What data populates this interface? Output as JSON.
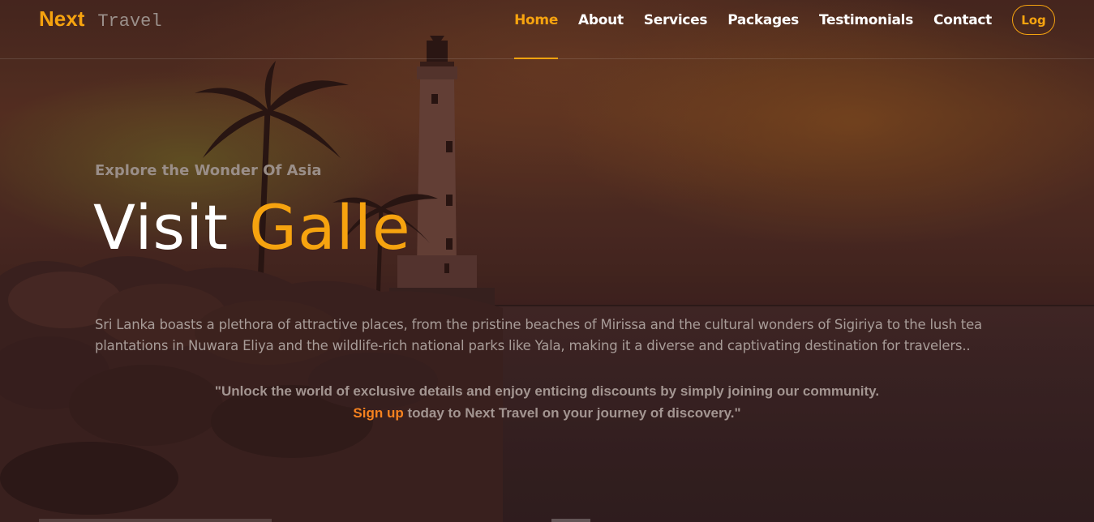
{
  "brand": {
    "main": "Next",
    "sub": "Travel"
  },
  "nav": {
    "items": [
      {
        "label": "Home",
        "active": true
      },
      {
        "label": "About",
        "active": false
      },
      {
        "label": "Services",
        "active": false
      },
      {
        "label": "Packages",
        "active": false
      },
      {
        "label": "Testimonials",
        "active": false
      },
      {
        "label": "Contact",
        "active": false
      }
    ],
    "log_label": "Log"
  },
  "hero": {
    "kicker": "Explore the Wonder Of Asia",
    "headline_white": "Visit",
    "headline_accent": "Galle",
    "description": "Sri Lanka boasts a plethora of attractive places, from the pristine beaches of Mirissa and the cultural wonders of Sigiriya to the lush tea plantations in Nuwara Eliya and the wildlife-rich national parks like Yala, making it a diverse and captivating destination for travelers..",
    "quote_line1": "\"Unlock the world of exclusive details and enjoy enticing discounts by simply joining our community.",
    "quote_signup": "Sign up",
    "quote_line2_rest": " today to Next Travel on your journey of discovery.\""
  },
  "colors": {
    "accent": "#f6a30f",
    "signup": "#f6821f"
  }
}
